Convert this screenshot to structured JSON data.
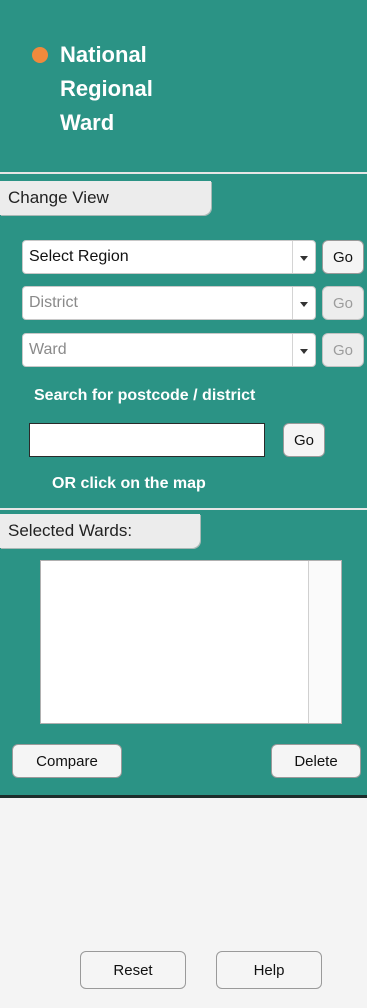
{
  "levels": [
    "National",
    "Regional",
    "Ward"
  ],
  "colors": {
    "panel": "#2b9385",
    "active_dot": "#f08a3c"
  },
  "change_view": {
    "tab_label": "Change View",
    "region_select": {
      "value": "Select Region",
      "go": "Go"
    },
    "district_select": {
      "value": "District",
      "go": "Go"
    },
    "ward_select": {
      "value": "Ward",
      "go": "Go"
    },
    "search_label": "Search for postcode / district",
    "search_value": "",
    "search_go": "Go",
    "or_label": "OR click on the map"
  },
  "selected_wards": {
    "tab_label": "Selected Wards:",
    "items": [],
    "compare": "Compare",
    "delete": "Delete"
  },
  "footer": {
    "reset": "Reset",
    "help": "Help"
  }
}
